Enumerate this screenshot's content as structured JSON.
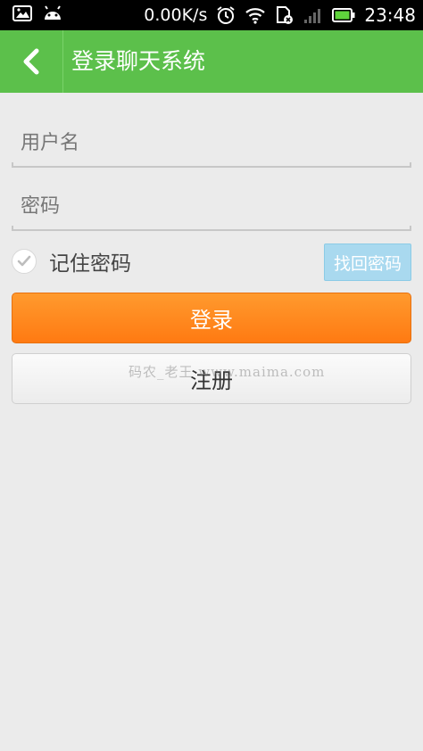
{
  "status_bar": {
    "net_speed": "0.00K/s",
    "time": "23:48"
  },
  "header": {
    "title": "登录聊天系统"
  },
  "form": {
    "username_placeholder": "用户名",
    "password_placeholder": "密码",
    "remember_label": "记住密码",
    "find_password_label": "找回密码",
    "login_label": "登录",
    "register_label": "注册"
  },
  "watermark": "码农_老王 www.maima.com",
  "colors": {
    "header_green": "#5cc04b",
    "login_orange": "#ff7a12",
    "find_blue": "#a9d9ef"
  }
}
